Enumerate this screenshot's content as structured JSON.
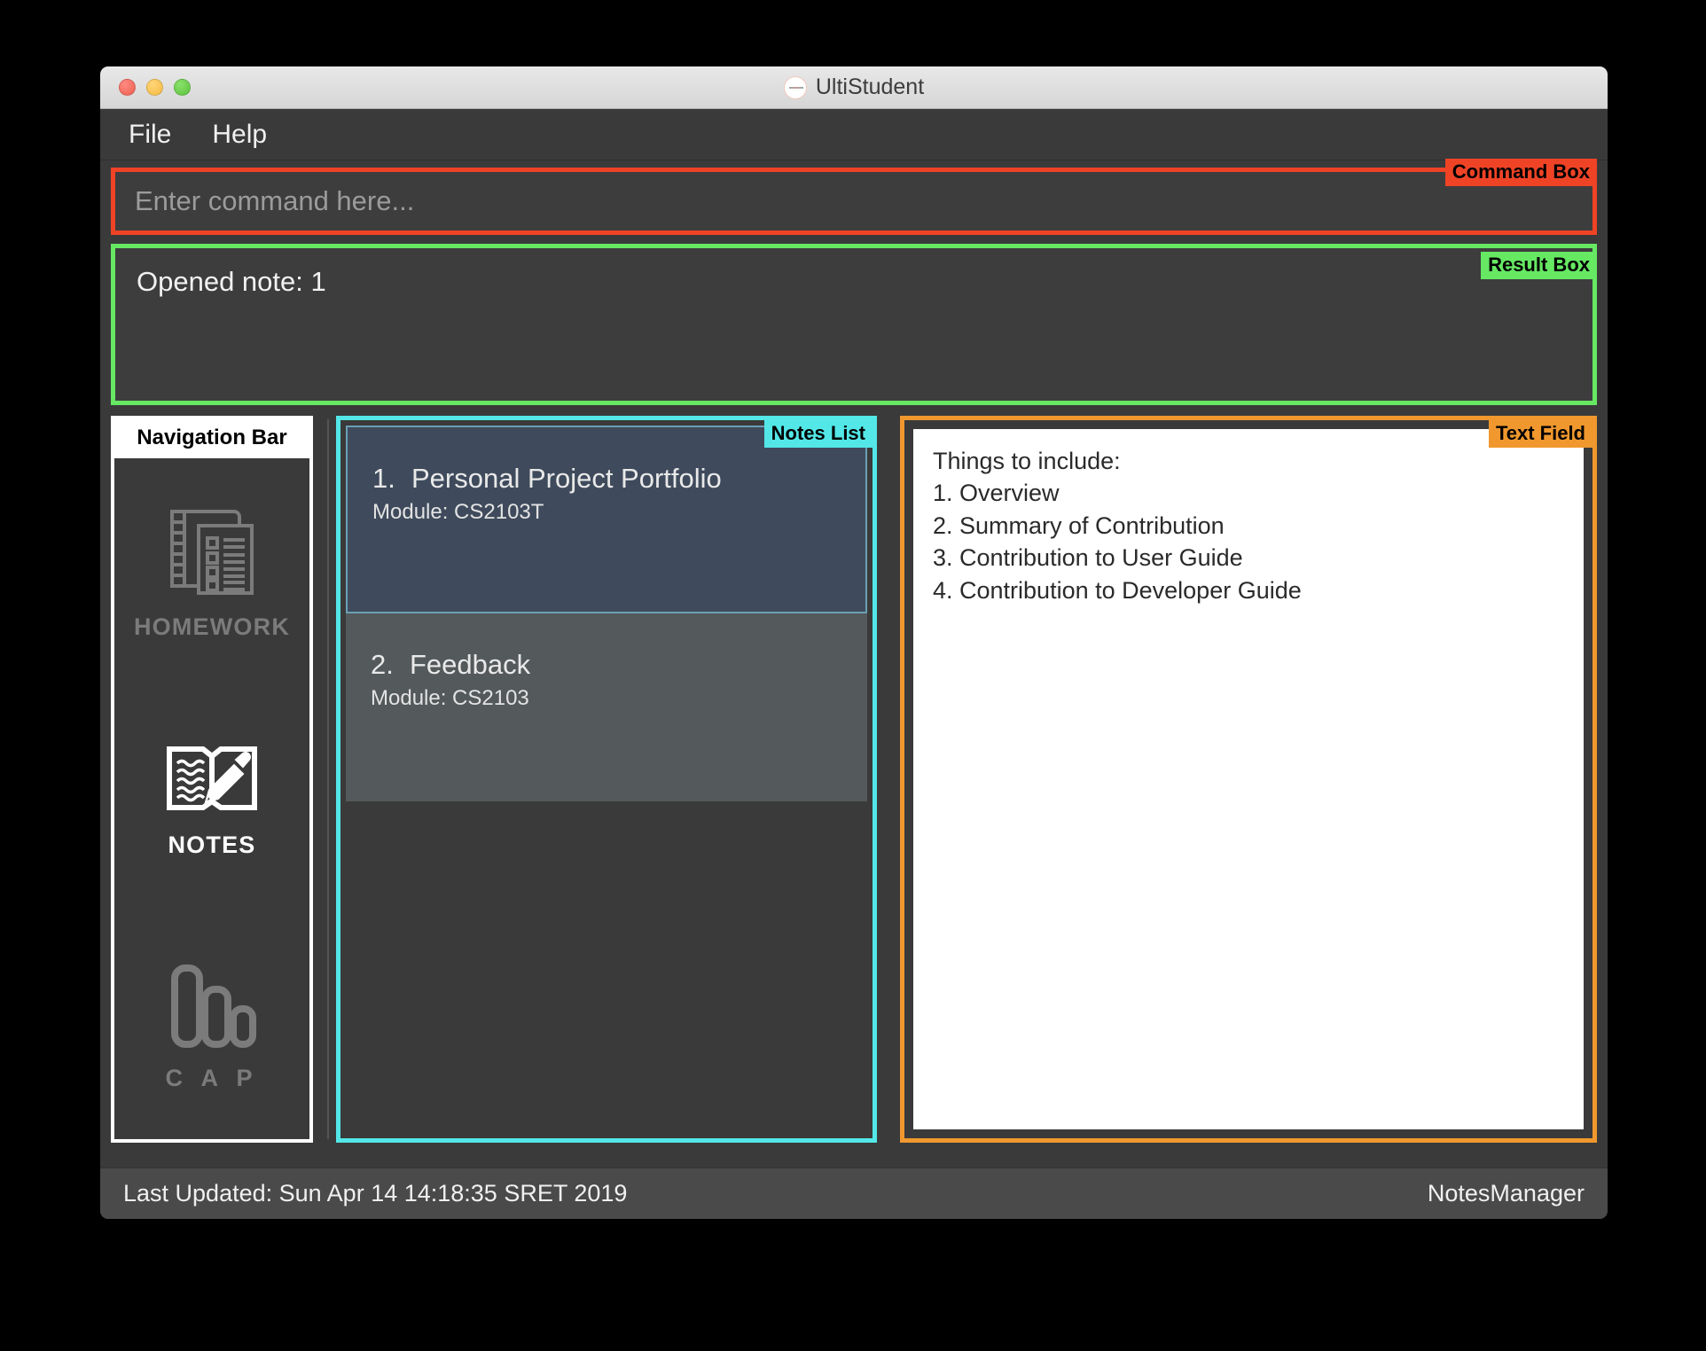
{
  "window": {
    "title": "UltiStudent",
    "app_icon": "app-logo-icon",
    "traffic_lights": [
      "close-button",
      "minimize-button",
      "maximize-button"
    ]
  },
  "menu": {
    "items": [
      {
        "label": "File"
      },
      {
        "label": "Help"
      }
    ]
  },
  "command_box": {
    "annotation": "Command Box",
    "placeholder": "Enter command here...",
    "value": "",
    "border_color": "#ef4326"
  },
  "result_box": {
    "annotation": "Result Box",
    "text": "Opened note: 1",
    "border_color": "#66e863"
  },
  "navigation_bar": {
    "title": "Navigation Bar",
    "border_color": "#ffffff",
    "items": [
      {
        "label": "HOMEWORK",
        "icon": "homework-notepad-icon",
        "active": false
      },
      {
        "label": "NOTES",
        "icon": "notes-book-pen-icon",
        "active": true
      },
      {
        "label": "C A P",
        "icon": "cap-bar-chart-icon",
        "active": false
      }
    ]
  },
  "notes_list": {
    "annotation": "Notes List",
    "border_color": "#53e7e8",
    "items": [
      {
        "index": "1.",
        "title": "Personal Project Portfolio",
        "module": "Module: CS2103T",
        "selected": true
      },
      {
        "index": "2.",
        "title": "Feedback",
        "module": "Module: CS2103",
        "selected": false
      }
    ]
  },
  "text_field": {
    "annotation": "Text Field",
    "border_color": "#f0982e",
    "lines": [
      "Things to include:",
      "1. Overview",
      "2. Summary of Contribution",
      "3. Contribution to User Guide",
      "4. Contribution to Developer Guide"
    ]
  },
  "status_bar": {
    "last_updated": "Last Updated: Sun Apr 14 14:18:35 SRET 2019",
    "manager": "NotesManager"
  }
}
